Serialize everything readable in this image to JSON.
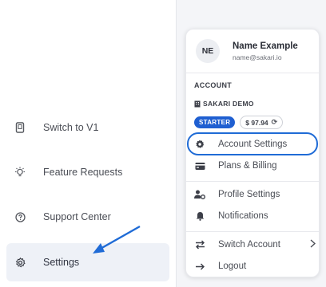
{
  "sidebar": {
    "items": [
      {
        "label": "Switch to V1",
        "icon": "device-icon"
      },
      {
        "label": "Feature Requests",
        "icon": "lightbulb-icon"
      },
      {
        "label": "Support Center",
        "icon": "help-circle-icon"
      },
      {
        "label": "Settings",
        "icon": "gear-icon",
        "active": true
      }
    ]
  },
  "menu": {
    "user": {
      "initials": "NE",
      "name": "Name Example",
      "email": "name@sakari.io"
    },
    "account_label": "ACCOUNT",
    "org_name": "SAKARI DEMO",
    "plan_badge": "STARTER",
    "credit": "$ 97.94",
    "items": [
      {
        "label": "Account Settings",
        "icon": "gear-icon"
      },
      {
        "label": "Plans & Billing",
        "icon": "credit-card-icon"
      },
      {
        "label": "Profile Settings",
        "icon": "user-settings-icon"
      },
      {
        "label": "Notifications",
        "icon": "bell-icon"
      },
      {
        "label": "Switch Account",
        "icon": "swap-icon"
      },
      {
        "label": "Logout",
        "icon": "logout-icon"
      }
    ]
  },
  "colors": {
    "accent": "#1f6bd6",
    "badge": "#1f5fd1",
    "active_bg": "#eef1f7"
  }
}
